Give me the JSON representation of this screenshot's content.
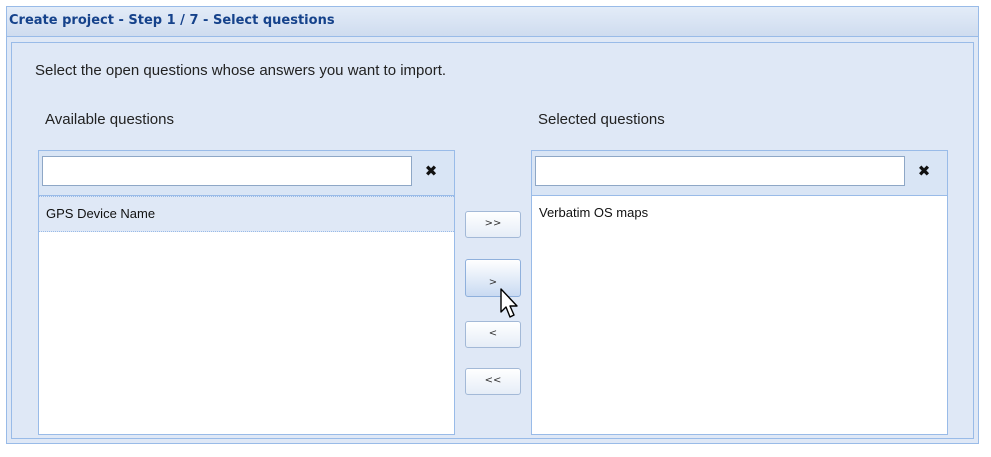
{
  "window": {
    "title": "Create project - Step 1 / 7 - Select questions"
  },
  "instruction": "Select the open questions whose answers you want to import.",
  "available": {
    "label": "Available questions",
    "filter_value": "",
    "clear_symbol": "✖",
    "items": [
      "GPS Device Name"
    ]
  },
  "selected": {
    "label": "Selected questions",
    "filter_value": "",
    "clear_symbol": "✖",
    "items": [
      "Verbatim OS maps"
    ]
  },
  "buttons": {
    "add_all": ">>",
    "add": ">",
    "remove": "<",
    "remove_all": "<<"
  },
  "icons": {
    "clear": "close-icon",
    "cursor": "mouse-pointer-icon"
  },
  "colors": {
    "title_text": "#15428b",
    "panel_bg": "#dfe8f6",
    "border": "#99bbe8"
  }
}
